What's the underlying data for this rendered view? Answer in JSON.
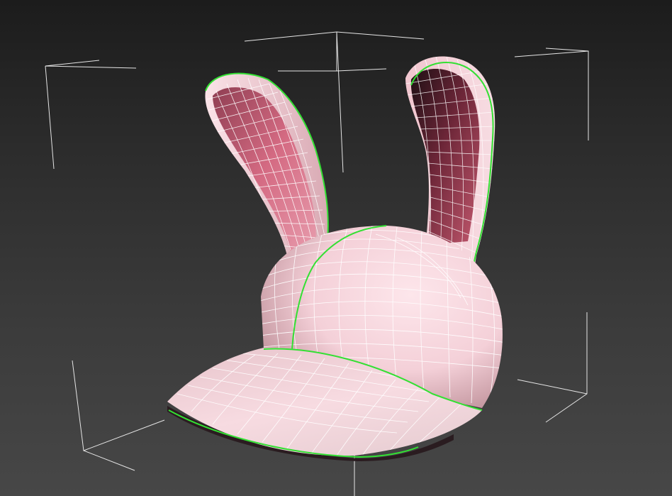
{
  "viewport": {
    "background_top": "#1c1c1c",
    "background_bottom": "#474747"
  },
  "object": {
    "kind": "bunny-ear-cap-mesh",
    "surface_color": "#f6d3da",
    "ear_inner_color": "#c44f6a",
    "wireframe_color": "#ffffff",
    "seam_color": "#33e033",
    "bbox_bracket_color": "#e6e6e6",
    "selected": true
  }
}
